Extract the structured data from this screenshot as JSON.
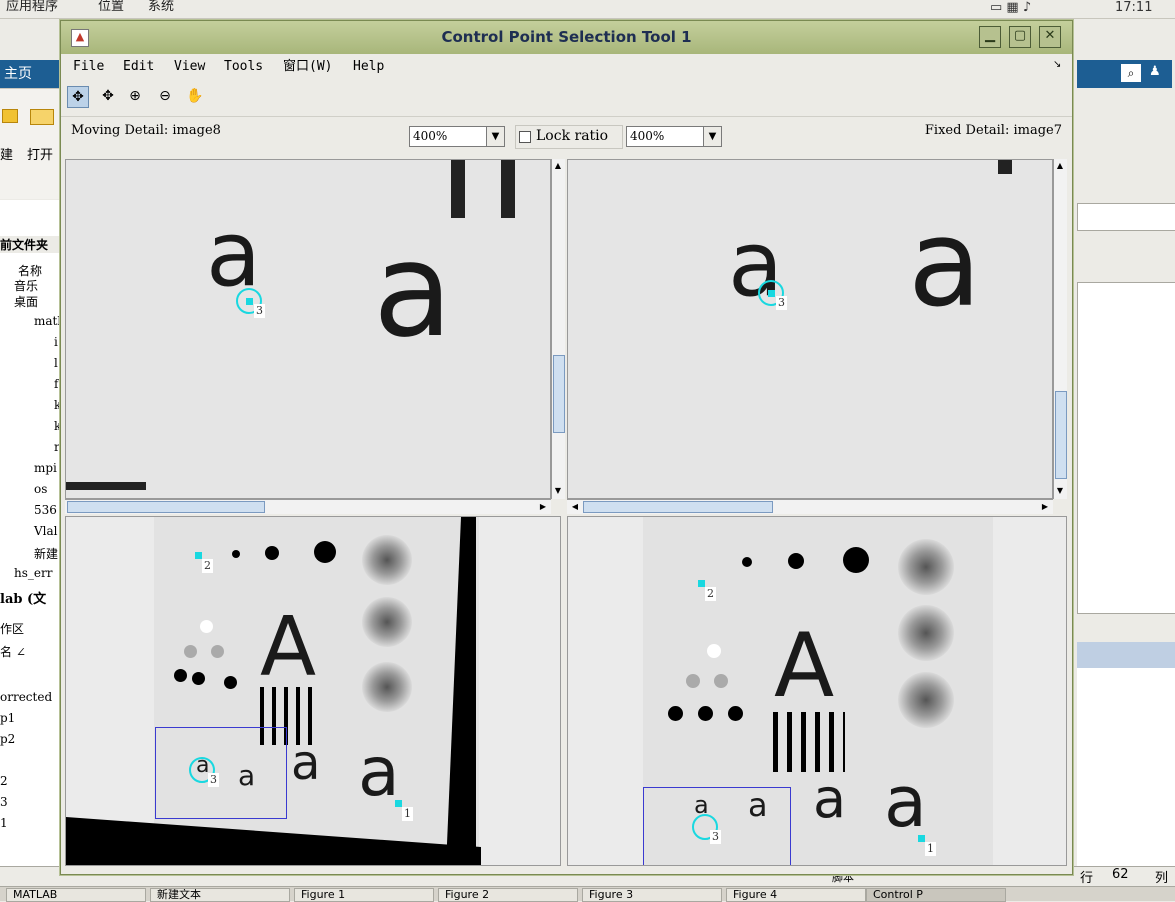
{
  "desktop": {
    "menus": [
      "应用程序",
      "位置",
      "系统"
    ],
    "clock": "17:11"
  },
  "bg_matlab": {
    "home_tab": "主页",
    "ribbon": {
      "new_label": "建",
      "open_label": "打开"
    },
    "current_folder": "前文件夹",
    "name_header": "名称",
    "tree": [
      "音乐",
      "桌面",
      "matl",
      "i",
      "l",
      "f",
      "k",
      "k",
      "r",
      "mpi",
      "os",
      "536",
      "Vlal",
      "新建",
      "hs_err"
    ],
    "ws_title": "lab (文",
    "ws_label": "作区",
    "ws_sub": "名 ∠",
    "cmd_lines": [
      "",
      "orrected",
      "p1",
      "p2",
      "",
      "2",
      "3",
      "1"
    ],
    "status_row_label": "行",
    "status_row_value": "62",
    "status_col_label": "列",
    "status_mode": "脚本",
    "taskbar": [
      "MATLAB",
      "新建文本",
      "Figure 1",
      "Figure 2",
      "Figure 3",
      "Figure 4",
      "Control P"
    ]
  },
  "window": {
    "title": "Control Point Selection Tool 1",
    "menus": [
      "File",
      "Edit",
      "View",
      "Tools",
      "窗口(W)",
      "Help"
    ],
    "tools": [
      {
        "name": "cp-select-tool",
        "glyph": "✥"
      },
      {
        "name": "cp-add-tool",
        "glyph": "✥"
      },
      {
        "name": "zoom-in-tool",
        "glyph": "⊕"
      },
      {
        "name": "zoom-out-tool",
        "glyph": "⊖"
      },
      {
        "name": "pan-tool",
        "glyph": "✋"
      }
    ],
    "moving_detail_label": "Moving Detail: image8",
    "fixed_detail_label": "Fixed Detail: image7",
    "moving_zoom": "400%",
    "fixed_zoom": "400%",
    "lock_ratio": "Lock ratio",
    "lock_checked": false,
    "point_labels": {
      "p1": "1",
      "p2": "2",
      "p3": "3"
    },
    "scene_letters": {
      "big": "A",
      "small": "a"
    },
    "colors": {
      "title_grad_top": "#c4cf9c",
      "title_text": "#1e2e52",
      "cp_marker": "#19d8e0",
      "detail_box": "#3a3ad0"
    }
  }
}
